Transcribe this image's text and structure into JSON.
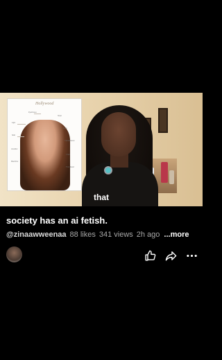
{
  "video": {
    "caption": "that",
    "card": {
      "brand": "Hollywood",
      "labels": [
        "Eyebrows",
        "Nose",
        "Lips",
        "Eyes",
        "Skin",
        "Cheekbones",
        "Jawline",
        "Chin",
        "Hairline",
        "Forehead"
      ]
    }
  },
  "post": {
    "title": "society has an ai fetish.",
    "author": "@zinaawweenaa",
    "likes": "88 likes",
    "views": "341 views",
    "age": "2h ago",
    "more": "...more"
  },
  "actions": {
    "like": "thumbs-up-icon",
    "share": "share-arrow-icon",
    "menu": "more-dots-icon"
  }
}
